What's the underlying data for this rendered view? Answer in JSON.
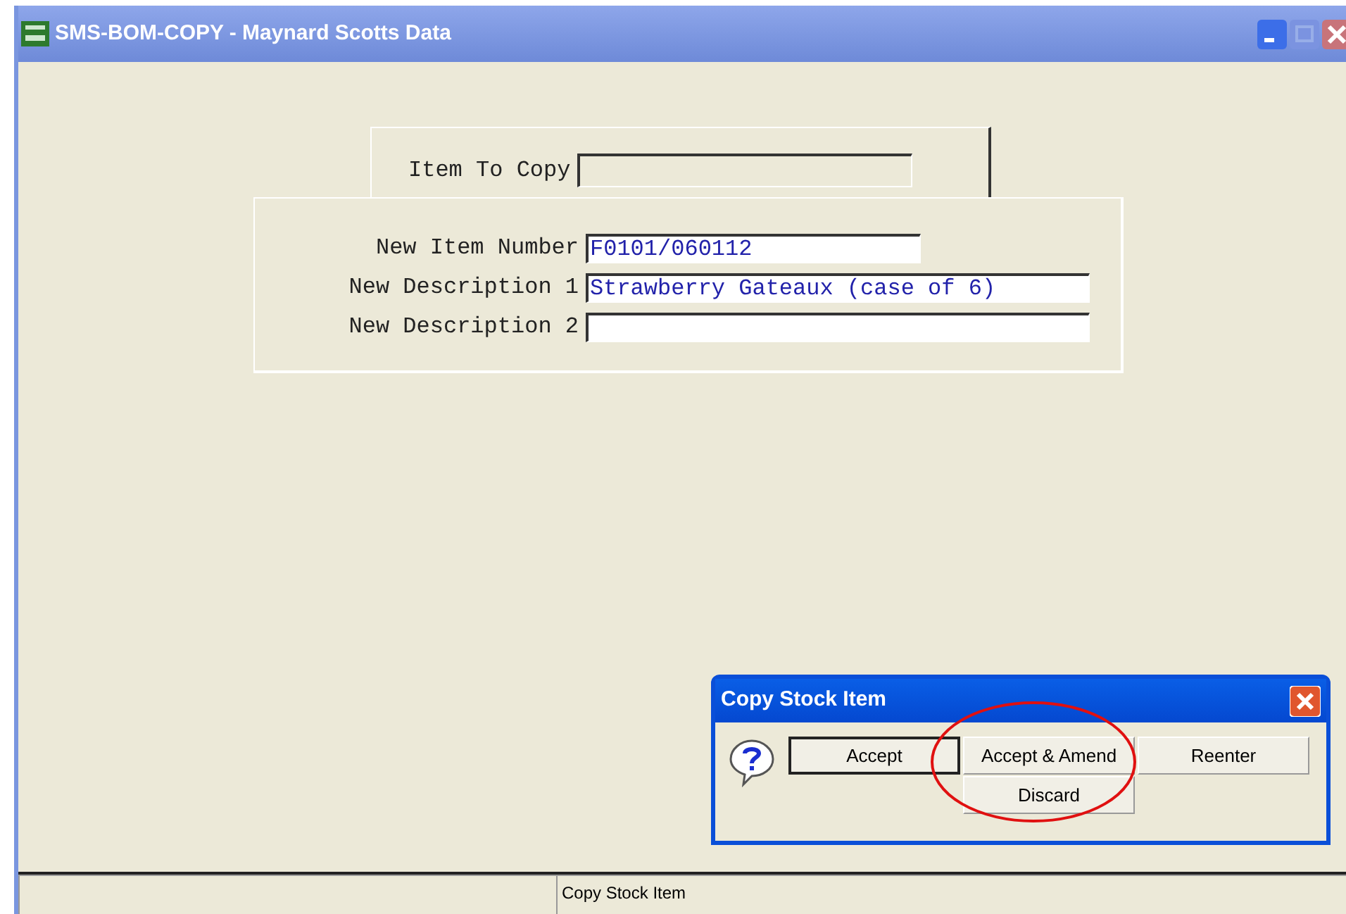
{
  "window": {
    "title": "SMS-BOM-COPY - Maynard Scotts Data"
  },
  "copy_panel": {
    "label": "Item To Copy"
  },
  "new_item_panel": {
    "fields": [
      {
        "label": "New Item Number",
        "value": "F0101/060112"
      },
      {
        "label": "New Description 1",
        "value": "Strawberry Gateaux (case of 6)"
      },
      {
        "label": "New Description 2"
      }
    ]
  },
  "dialog": {
    "title": "Copy Stock Item",
    "buttons": [
      {
        "label": "Accept",
        "default": true
      },
      {
        "label": "Accept & Amend",
        "default": false,
        "highlighted": true
      },
      {
        "label": "Reenter",
        "default": false
      },
      {
        "label": "Discard",
        "default": false
      }
    ]
  },
  "status_bar": {
    "message": "Copy Stock Item"
  }
}
